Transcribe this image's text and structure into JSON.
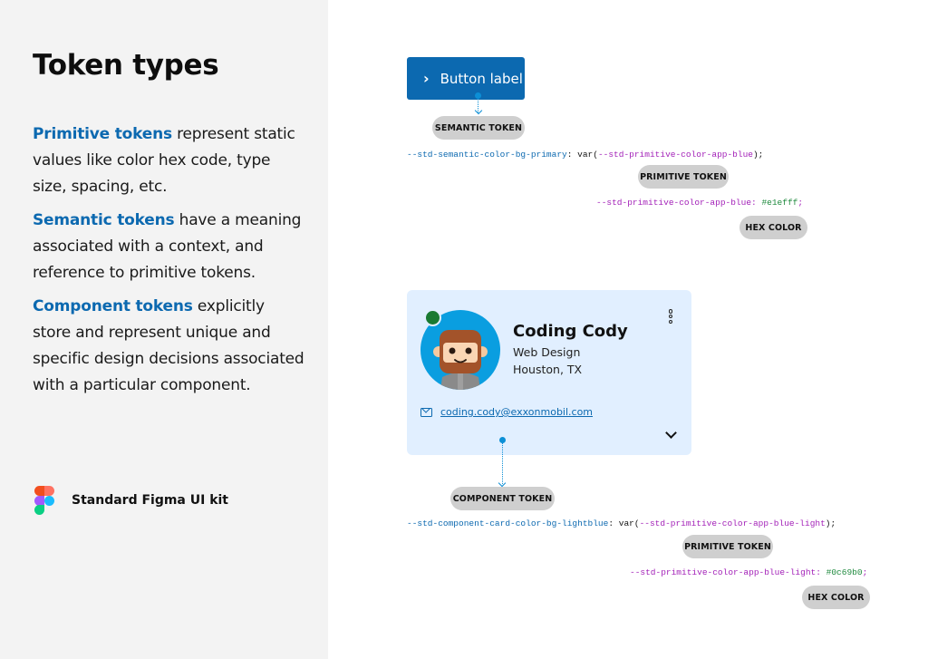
{
  "left_panel": {
    "title": "Token types",
    "paragraphs": [
      {
        "highlight": "Primitive tokens",
        "text": " represent static values like color hex code, type size, spacing, etc."
      },
      {
        "highlight": "Semantic tokens",
        "text": " have a meaning associated with a context, and reference to primitive tokens."
      },
      {
        "highlight": "Component tokens",
        "text": " explicitly store and represent unique and specific design decisions associated with a particular component."
      }
    ],
    "brand": {
      "icon": "figma-logo-icon",
      "label": "Standard Figma UI kit"
    }
  },
  "semantic_example": {
    "button": {
      "icon": "chevron-right-icon",
      "chevron": "›",
      "label": "Button label"
    },
    "pills": {
      "semantic": "SEMANTIC TOKEN",
      "primitive": "PRIMITIVE TOKEN",
      "hex": "HEX COLOR"
    },
    "code_line_1": {
      "name": "--std-semantic-color-bg-primary",
      "sep": ": var(",
      "ref": "--std-primitive-color-app-blue",
      "end": ");"
    },
    "code_line_2": {
      "name": "--std-primitive-color-app-blue",
      "sep": ": ",
      "value": "#e1efff",
      "end": ";"
    }
  },
  "component_example": {
    "card": {
      "name": "Coding Cody",
      "role": "Web Design",
      "location": "Houston, TX",
      "email": "coding.cody@exxonmobil.com",
      "status_color": "#1a7a32",
      "menu_icon": "kebab-menu-icon",
      "expand_icon": "chevron-down-icon",
      "email_icon": "mail-icon"
    },
    "pills": {
      "component": "COMPONENT TOKEN",
      "primitive": "PRIMITIVE TOKEN",
      "hex": "HEX COLOR"
    },
    "code_line_1": {
      "name": "--std-component-card-color-bg-lightblue",
      "sep": ": var(",
      "ref": "--std-primitive-color-app-blue-light",
      "end": ");"
    },
    "code_line_2": {
      "name": "--std-primitive-color-app-blue-light",
      "sep": ": ",
      "value": "#0c69b0",
      "end": ";"
    }
  },
  "colors": {
    "accent_blue": "#0c69b0",
    "card_bg": "#e1efff",
    "pill_bg": "#cfcfcf",
    "code_purple": "#a321b8",
    "code_green": "#1f8a3e",
    "connector": "#0c8fd6"
  }
}
